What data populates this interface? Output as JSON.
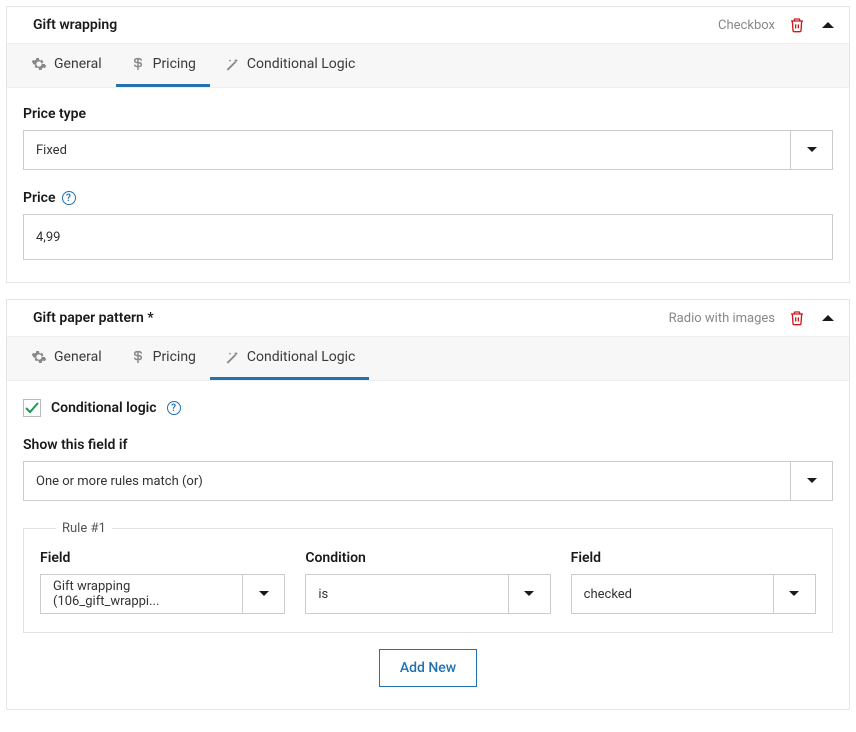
{
  "panels": [
    {
      "title": "Gift wrapping",
      "type_label": "Checkbox",
      "tabs": [
        "General",
        "Pricing",
        "Conditional Logic"
      ],
      "active_tab": 1,
      "pricing": {
        "price_type_label": "Price type",
        "price_type_value": "Fixed",
        "price_label": "Price",
        "price_value": "4,99"
      }
    },
    {
      "title": "Gift paper pattern *",
      "type_label": "Radio with images",
      "tabs": [
        "General",
        "Pricing",
        "Conditional Logic"
      ],
      "active_tab": 2,
      "conditional": {
        "checkbox_label": "Conditional logic",
        "show_label": "Show this field if",
        "match_value": "One or more rules match (or)",
        "rule_title": "Rule #1",
        "col1_label": "Field",
        "col1_value": "Gift wrapping (106_gift_wrappi...",
        "col2_label": "Condition",
        "col2_value": "is",
        "col3_label": "Field",
        "col3_value": "checked",
        "add_new": "Add New"
      }
    }
  ]
}
